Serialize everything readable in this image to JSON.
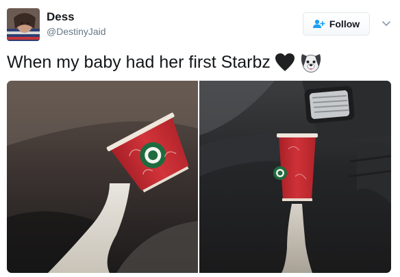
{
  "tweet": {
    "display_name": "Dess",
    "handle": "@DestinyJaid",
    "follow_label": "Follow",
    "text": "When my baby had her first Starbz"
  },
  "icons": {
    "follow": "add-user-icon",
    "menu": "chevron-down-icon",
    "emoji_1": "black-heart-icon",
    "emoji_2": "dog-face-icon"
  },
  "colors": {
    "cup_red": "#c8282f",
    "starbucks_green": "#1e6b3f",
    "text_primary": "#14171a",
    "text_secondary": "#657786"
  }
}
